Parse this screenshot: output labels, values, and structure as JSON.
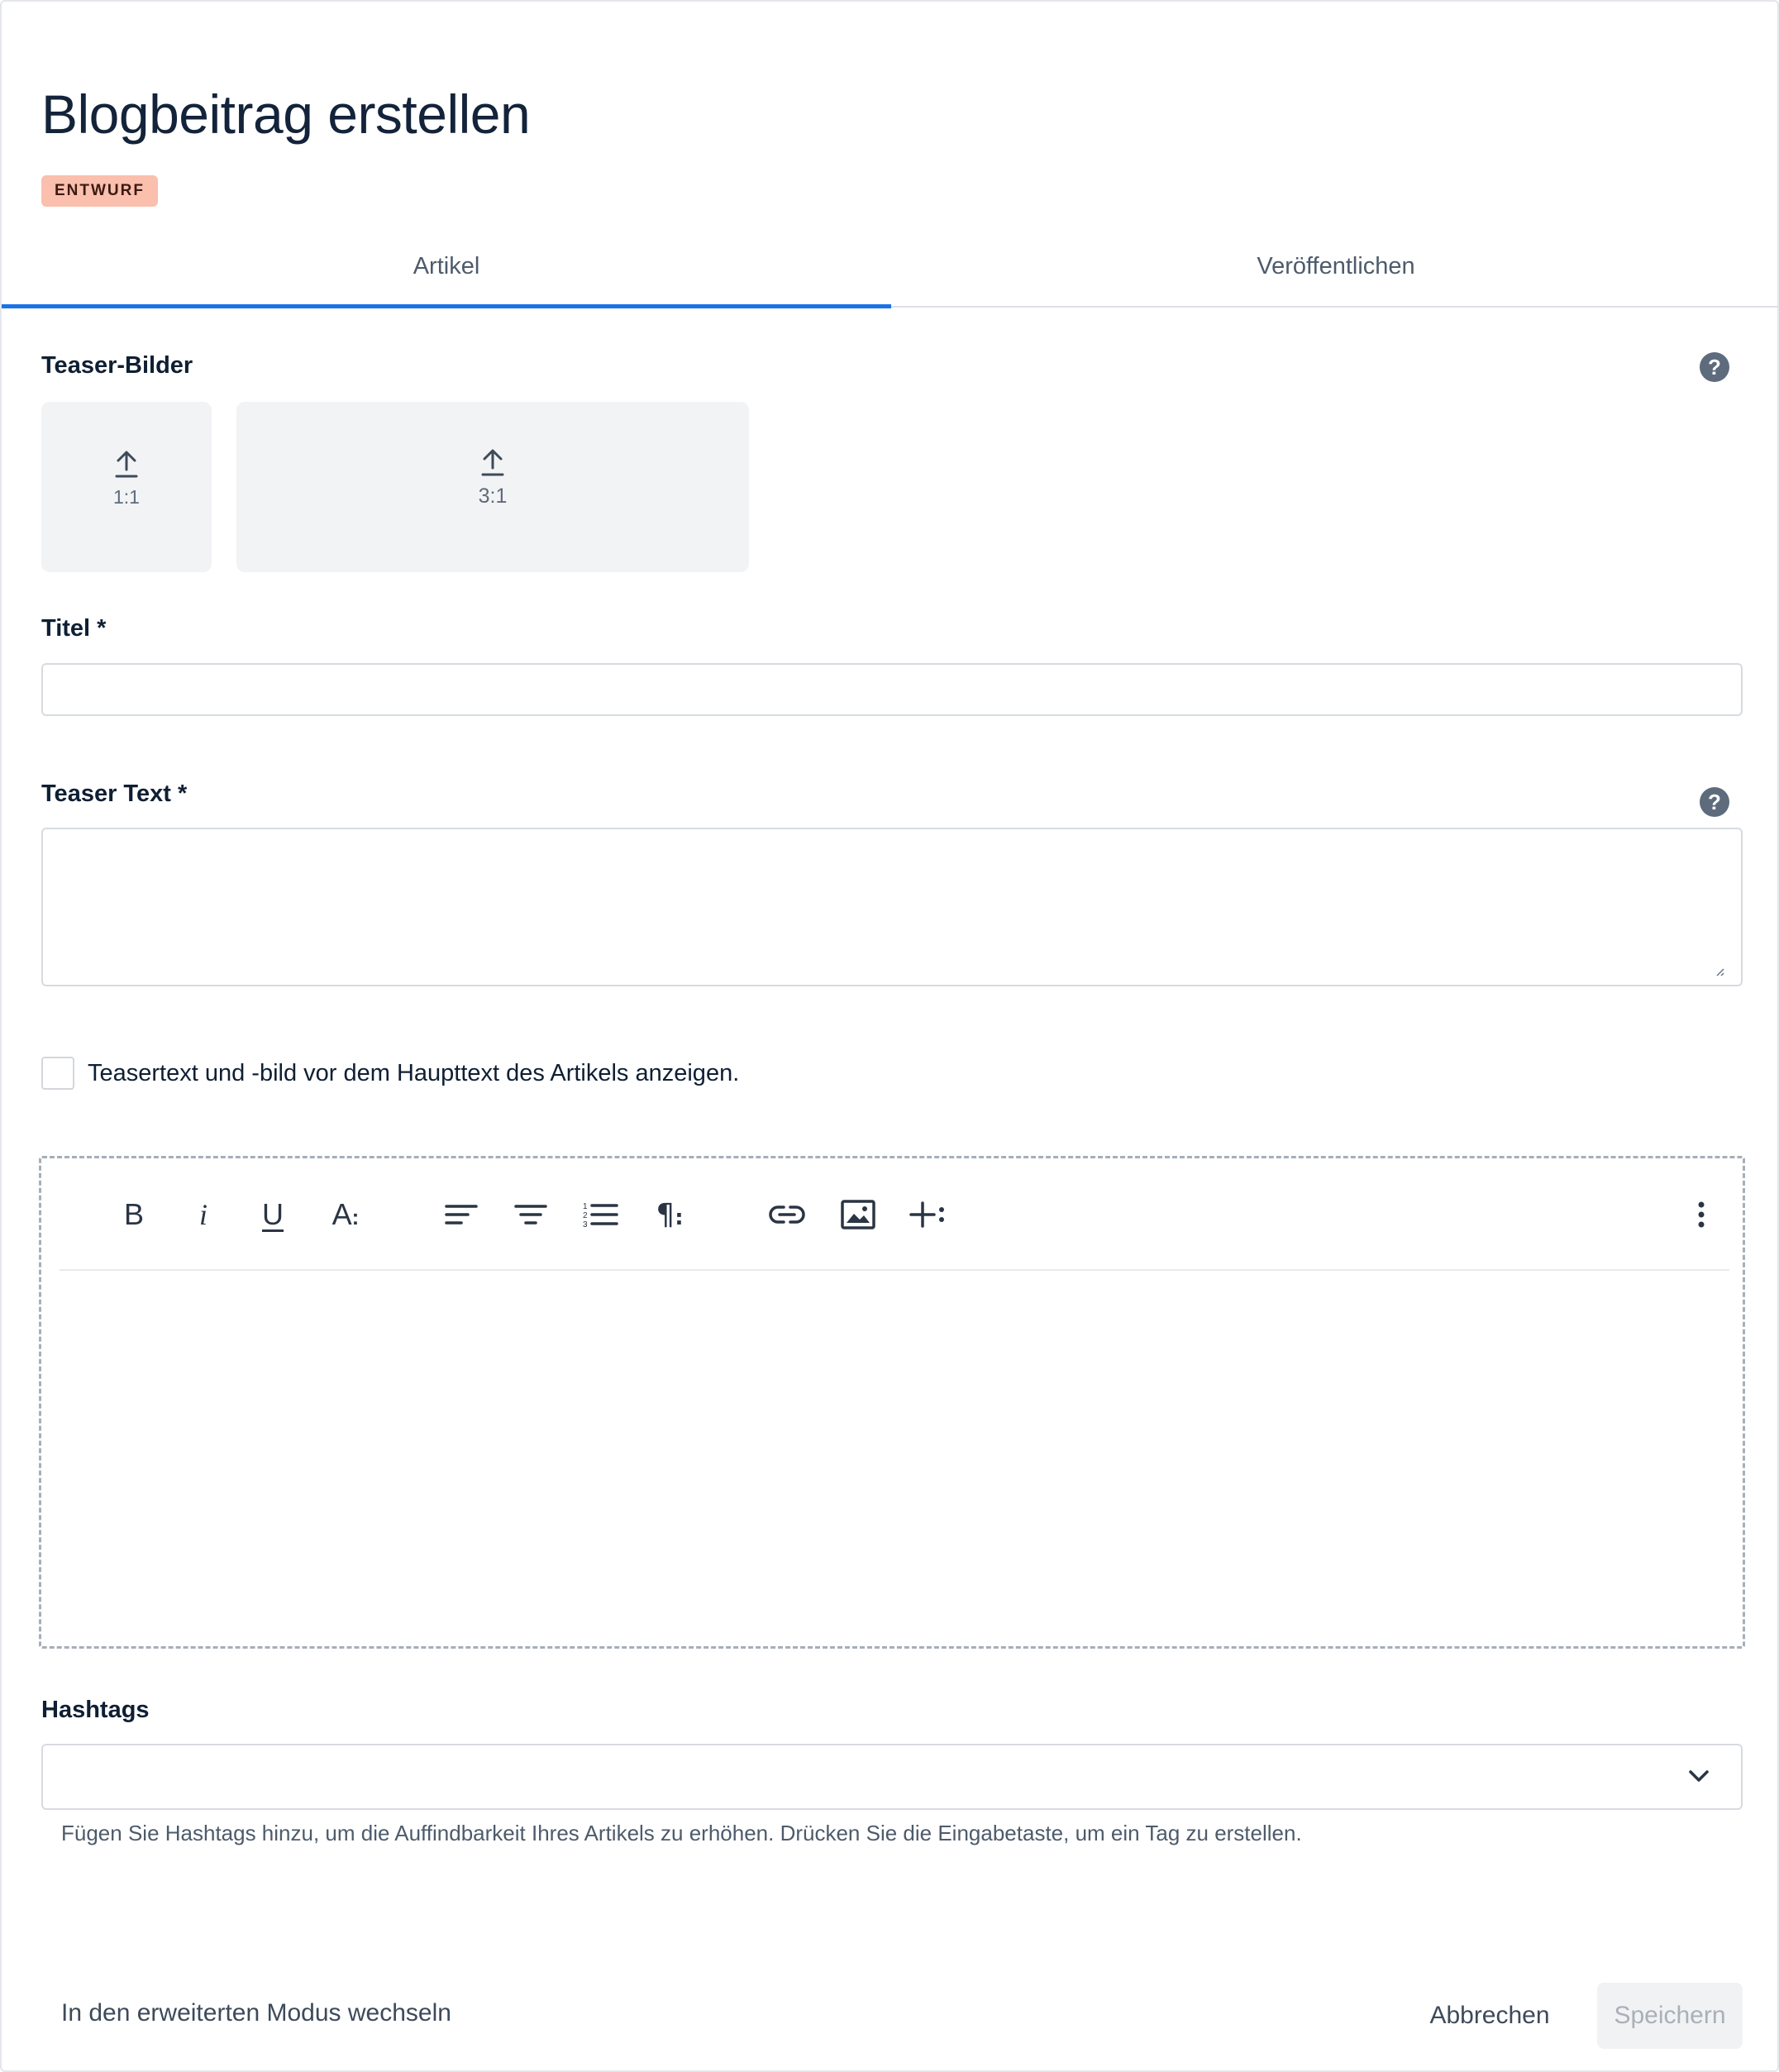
{
  "header": {
    "title": "Blogbeitrag erstellen",
    "status_badge": "ENTWURF"
  },
  "tabs": [
    {
      "label": "Artikel",
      "active": true
    },
    {
      "label": "Veröffentlichen",
      "active": false
    }
  ],
  "teaser_images": {
    "label": "Teaser-Bilder",
    "help_icon": "question-circle-icon",
    "uploads": [
      {
        "ratio": "1:1",
        "icon": "upload-arrow-icon"
      },
      {
        "ratio": "3:1",
        "icon": "upload-arrow-icon"
      }
    ]
  },
  "title_field": {
    "label": "Titel *",
    "value": ""
  },
  "teaser_text": {
    "label": "Teaser Text *",
    "value": "",
    "help_icon": "question-circle-icon"
  },
  "show_teaser_checkbox": {
    "label": "Teasertext und -bild vor dem Haupttext des Artikels anzeigen.",
    "checked": false
  },
  "editor": {
    "toolbar": [
      "bold",
      "italic",
      "underline",
      "font-size",
      "align-left",
      "align-center",
      "numbered-list",
      "paragraph",
      "link",
      "image",
      "insert",
      "more"
    ],
    "bold_glyph": "B",
    "italic_glyph": "i",
    "underline_glyph": "U",
    "fontsize_glyph": "A",
    "paragraph_glyph": "¶",
    "content": ""
  },
  "hashtags": {
    "label": "Hashtags",
    "value": "",
    "hint": "Fügen Sie Hashtags hinzu, um die Auffindbarkeit Ihres Artikels zu erhöhen. Drücken Sie die Eingabetaste, um ein Tag zu erstellen."
  },
  "footer": {
    "advanced_mode": "In den erweiterten Modus wechseln",
    "cancel": "Abbrechen",
    "save": "Speichern"
  },
  "colors": {
    "accent": "#1a73e8",
    "badge_bg": "#fbbfae",
    "help_icon": "#5d6b7d"
  }
}
